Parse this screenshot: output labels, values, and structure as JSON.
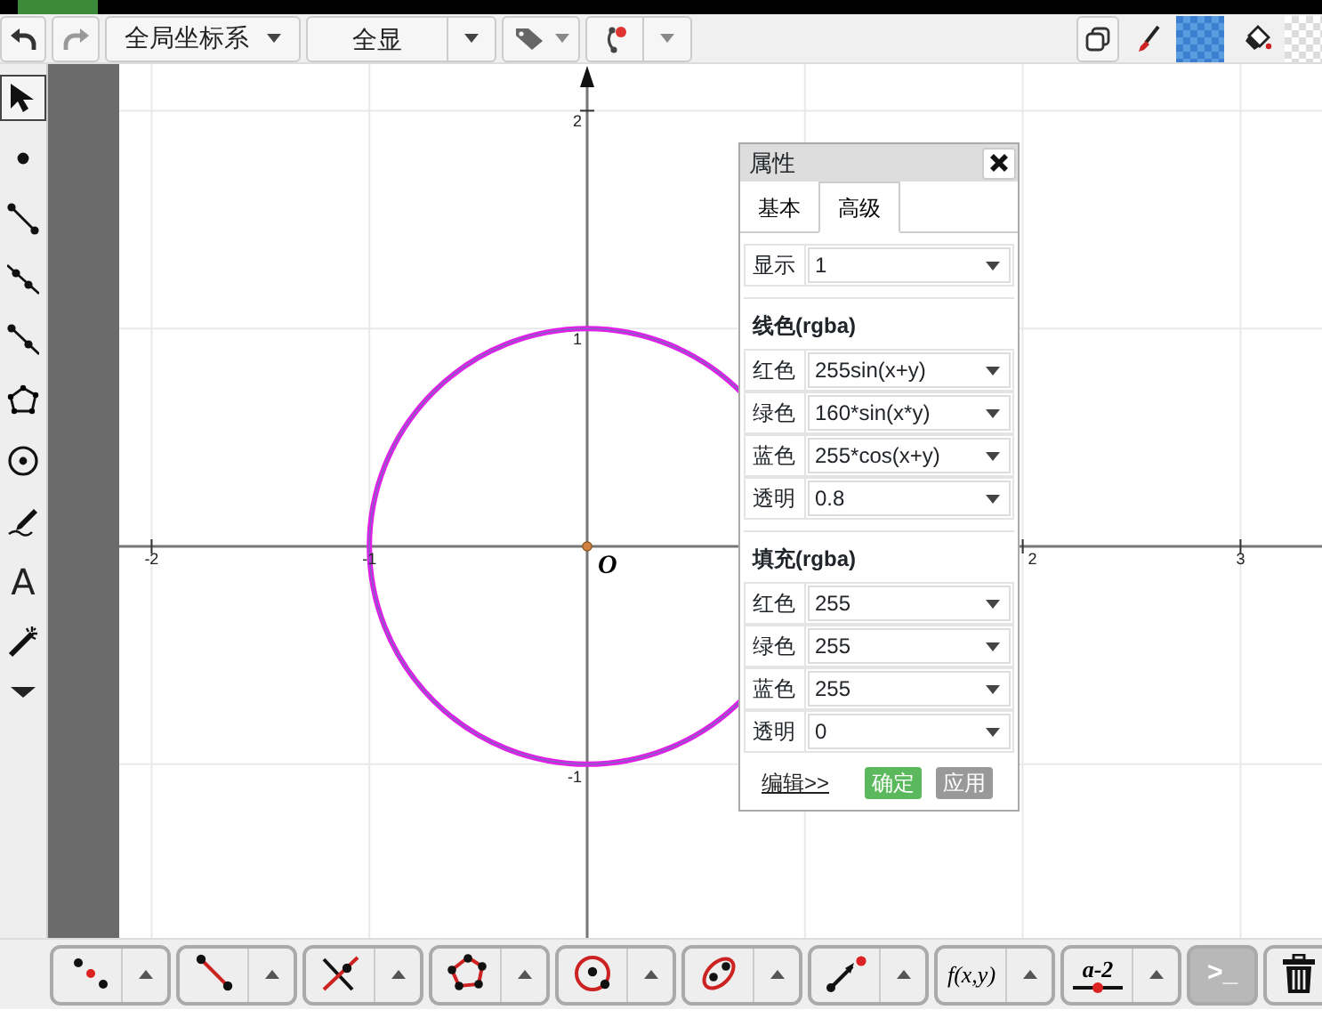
{
  "toolbar": {
    "coord_dropdown": "全局坐标系",
    "view_dropdown": "全显"
  },
  "tools": [
    {
      "kind": "arrow",
      "selected": true
    },
    {
      "kind": "point",
      "selected": false
    },
    {
      "kind": "segment",
      "selected": false
    },
    {
      "kind": "line",
      "selected": false
    },
    {
      "kind": "ray",
      "selected": false
    },
    {
      "kind": "polygon",
      "selected": false
    },
    {
      "kind": "circle",
      "selected": false
    },
    {
      "kind": "pen",
      "selected": false
    },
    {
      "kind": "text",
      "label": "A",
      "selected": false
    },
    {
      "kind": "wand",
      "selected": false
    },
    {
      "kind": "more",
      "selected": false
    }
  ],
  "canvas": {
    "x_ticks": [
      "-2",
      "-1",
      "2",
      "3"
    ],
    "y_ticks": [
      "2",
      "1",
      "-1"
    ],
    "origin_label": "O"
  },
  "panel": {
    "title": "属性",
    "tabs": [
      {
        "label": "基本",
        "selected": false
      },
      {
        "label": "高级",
        "selected": true
      }
    ],
    "display": {
      "label": "显示",
      "value": "1"
    },
    "sections": [
      {
        "title": "线色(rgba)",
        "rows": [
          {
            "label": "红色",
            "value": "255sin(x+y)"
          },
          {
            "label": "绿色",
            "value": "160*sin(x*y)"
          },
          {
            "label": "蓝色",
            "value": "255*cos(x+y)"
          },
          {
            "label": "透明",
            "value": "0.8"
          }
        ]
      },
      {
        "title": "填充(rgba)",
        "rows": [
          {
            "label": "红色",
            "value": "255"
          },
          {
            "label": "绿色",
            "value": "255"
          },
          {
            "label": "蓝色",
            "value": "255"
          },
          {
            "label": "透明",
            "value": "0"
          }
        ]
      }
    ],
    "edit_link": "编辑>>",
    "buttons": [
      {
        "label": "确定",
        "kind": "primary"
      },
      {
        "label": "应用",
        "kind": "secondary"
      }
    ]
  },
  "bottom_tools": [
    {
      "kind": "points",
      "has_menu": true
    },
    {
      "kind": "segment",
      "has_menu": true
    },
    {
      "kind": "intersect",
      "has_menu": true
    },
    {
      "kind": "polygon",
      "has_menu": true
    },
    {
      "kind": "circle",
      "has_menu": true
    },
    {
      "kind": "conic",
      "has_menu": true
    },
    {
      "kind": "vector",
      "has_menu": true
    },
    {
      "kind": "function",
      "label": "f(x,y)",
      "has_menu": true
    },
    {
      "kind": "slider",
      "label": "a-2",
      "has_menu": true
    },
    {
      "kind": "console",
      "label": ">_",
      "has_menu": false
    },
    {
      "kind": "trash",
      "has_menu": false
    }
  ]
}
